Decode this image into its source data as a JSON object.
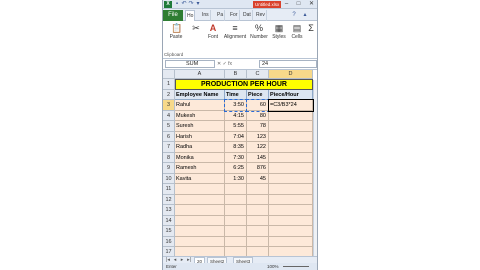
{
  "titlebar": {
    "filename": "Untitled.xlsx",
    "qat": [
      "save-icon",
      "undo-icon",
      "redo-icon",
      "dropdown-icon"
    ]
  },
  "tabs": [
    "File",
    "Ho",
    "Ins",
    "Pa",
    "For",
    "Dat",
    "Rev"
  ],
  "ribbon": {
    "paste": "Paste",
    "font": "Font",
    "alignment": "Alignment",
    "number": "Number",
    "styles": "Styles",
    "cells": "Cells",
    "clipboard": "Clipboard"
  },
  "formula_bar": {
    "name_box": "SUM",
    "fx": "✕ ✓ fx",
    "value": "24"
  },
  "columns": [
    "A",
    "B",
    "C",
    "D"
  ],
  "rows": [
    "1",
    "2",
    "3",
    "4",
    "5",
    "6",
    "7",
    "8",
    "9",
    "10",
    "11",
    "12",
    "13",
    "14",
    "15",
    "16",
    "17",
    "18"
  ],
  "sheet_title": "PRODUCTION PER HOUR",
  "table_headers": [
    "Employee Name",
    "Time",
    "Piece",
    "Piece/Hour"
  ],
  "table_rows": [
    {
      "name": "Rahul",
      "time": "3:50",
      "piece": "60",
      "rate": "=C3/B3*24"
    },
    {
      "name": "Mukesh",
      "time": "4:15",
      "piece": "80",
      "rate": ""
    },
    {
      "name": "Suresh",
      "time": "5:55",
      "piece": "78",
      "rate": ""
    },
    {
      "name": "Harish",
      "time": "7:04",
      "piece": "123",
      "rate": ""
    },
    {
      "name": "Radha",
      "time": "8:35",
      "piece": "122",
      "rate": ""
    },
    {
      "name": "Monika",
      "time": "7:30",
      "piece": "145",
      "rate": ""
    },
    {
      "name": "Ramesh",
      "time": "6:25",
      "piece": "876",
      "rate": ""
    },
    {
      "name": "Kavita",
      "time": "1:30",
      "piece": "45",
      "rate": ""
    }
  ],
  "sheet_tabs": [
    "20",
    "Sheet2",
    "Sheet3"
  ],
  "status": {
    "mode": "Enter",
    "zoom": "100%"
  },
  "colors": {
    "title_fill": "#ffff00",
    "header_fill": "#dce6f1",
    "cell_fill": "#fde9d9",
    "file_tab": "#2e7d32",
    "filename_bg": "#d9412c"
  }
}
